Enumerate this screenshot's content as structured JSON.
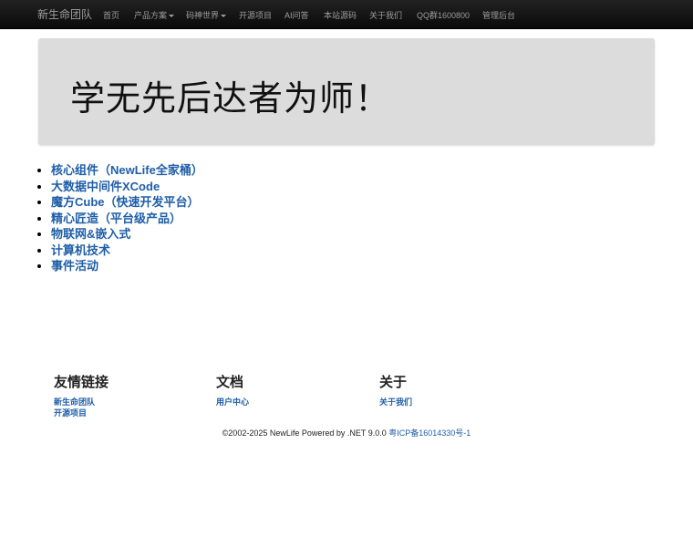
{
  "navbar": {
    "brand": "新生命团队",
    "items": [
      {
        "label": "首页"
      },
      {
        "label": "产品方案"
      },
      {
        "label": "码神世界"
      },
      {
        "label": "开源项目"
      },
      {
        "label": "AI问答"
      },
      {
        "label": "本站源码"
      },
      {
        "label": "关于我们"
      },
      {
        "label": "QQ群1600800"
      },
      {
        "label": "管理后台"
      }
    ]
  },
  "jumbotron": {
    "title": "学无先后达者为师！"
  },
  "links": [
    "核心组件（NewLife全家桶）",
    "大数据中间件XCode",
    "魔方Cube（快速开发平台）",
    "精心匠造（平台级产品）",
    "物联网&嵌入式",
    "计算机技术",
    "事件活动"
  ],
  "footer": {
    "columns": [
      {
        "title": "友情链接",
        "links": [
          "新生命团队",
          "开源项目"
        ]
      },
      {
        "title": "文档",
        "links": [
          "用户中心"
        ]
      },
      {
        "title": "关于",
        "links": [
          "关于我们"
        ]
      }
    ],
    "copyright": "©2002-2025 NewLife Powered by .NET 9.0.0",
    "icp": "粤ICP备16014330号-1"
  }
}
